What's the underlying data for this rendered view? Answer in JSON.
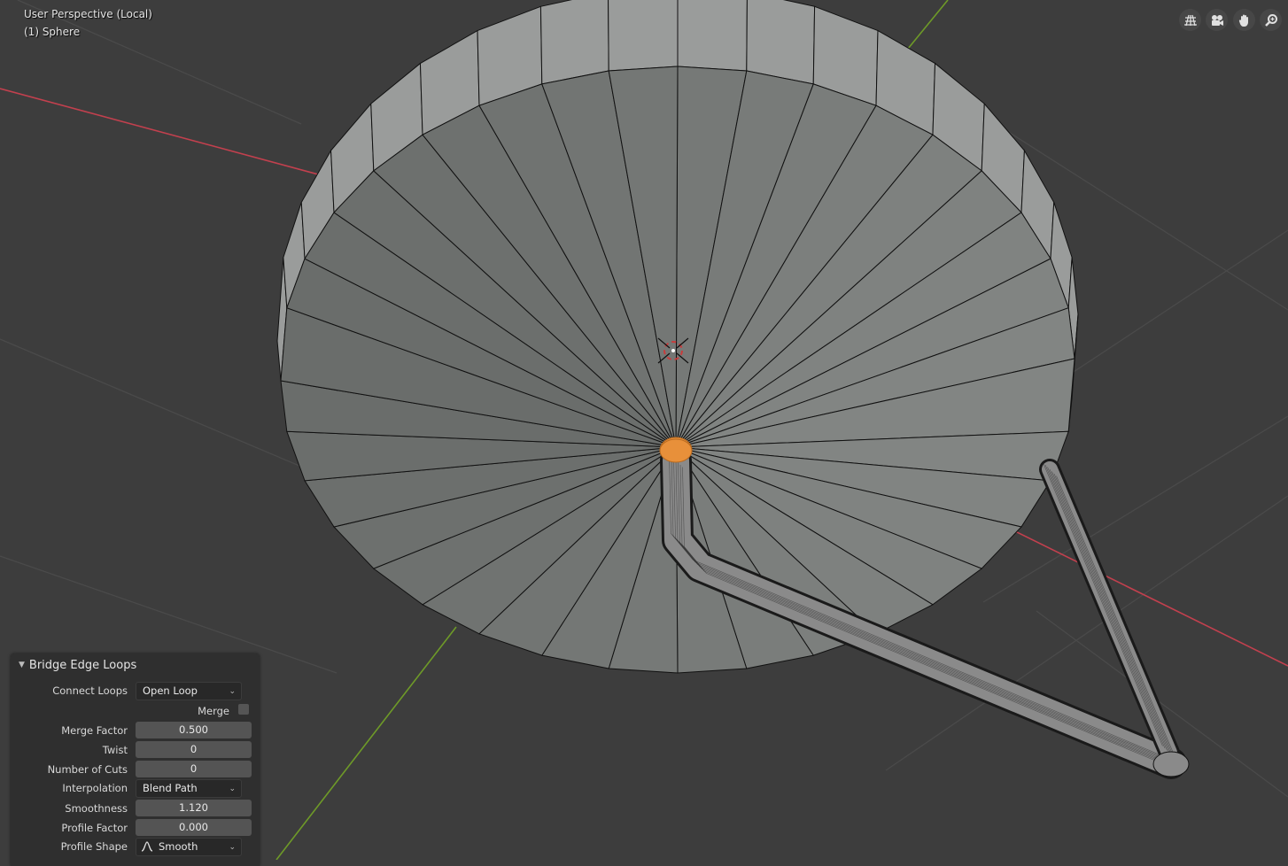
{
  "viewport": {
    "view_name": "User Perspective (Local)",
    "object_name": "(1) Sphere",
    "colors": {
      "background": "#3d3d3d",
      "grid": "#4a4a4a",
      "axis_x": "#c2404e",
      "axis_y": "#6e9a28",
      "mesh_face": "#7c7f7d",
      "mesh_face_light": "#9a9c9b",
      "selection": "#e8903a"
    }
  },
  "nav_gizmo": {
    "buttons": [
      {
        "name": "toggle-camera-view",
        "icon": "grid-perspective-icon"
      },
      {
        "name": "camera",
        "icon": "camera-icon"
      },
      {
        "name": "pan",
        "icon": "hand-icon"
      },
      {
        "name": "zoom",
        "icon": "magnifier-icon"
      }
    ]
  },
  "operator_panel": {
    "title": "Bridge Edge Loops",
    "connect_loops": {
      "label": "Connect Loops",
      "value": "Open Loop"
    },
    "merge": {
      "label": "Merge",
      "checked": false
    },
    "merge_factor": {
      "label": "Merge Factor",
      "value": "0.500"
    },
    "twist": {
      "label": "Twist",
      "value": "0"
    },
    "number_of_cuts": {
      "label": "Number of Cuts",
      "value": "0"
    },
    "interpolation": {
      "label": "Interpolation",
      "value": "Blend Path"
    },
    "smoothness": {
      "label": "Smoothness",
      "value": "1.120"
    },
    "profile_factor": {
      "label": "Profile Factor",
      "value": "0.000"
    },
    "profile_shape": {
      "label": "Profile Shape",
      "value": "Smooth"
    }
  }
}
